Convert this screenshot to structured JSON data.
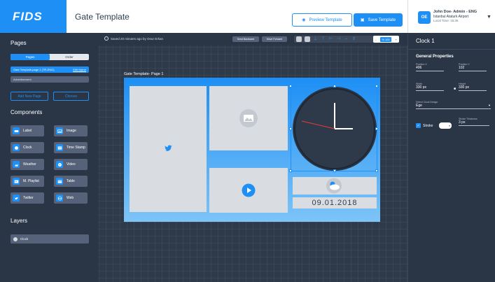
{
  "app": {
    "logo": "FIDS",
    "title": "Gate Template"
  },
  "header": {
    "preview_label": "Preview Template",
    "save_label": "Save Template"
  },
  "user": {
    "initials": "OE",
    "name": "John Doe- Admin - ENG",
    "location": "Istanbul Ataturk Airport",
    "time": "Local Time: 15:35"
  },
  "left": {
    "pages_title": "Pages",
    "tabs": [
      {
        "label": "Pages"
      },
      {
        "label": "Order"
      }
    ],
    "pages": [
      {
        "label": "Gate Template-page 1 (TR-ENG)",
        "edit": "Edit Name"
      },
      {
        "label": "Advertisement"
      }
    ],
    "add_page": "Add New Page",
    "choose": "Choose",
    "components_title": "Components",
    "components": [
      {
        "label": "Label",
        "icon": "label-icon"
      },
      {
        "label": "Image",
        "icon": "image-icon"
      },
      {
        "label": "Clock",
        "icon": "clock-icon"
      },
      {
        "label": "Time Stamp",
        "icon": "timestamp-icon"
      },
      {
        "label": "Weather",
        "icon": "weather-icon"
      },
      {
        "label": "Video",
        "icon": "video-icon"
      },
      {
        "label": "M. Playlist",
        "icon": "playlist-icon"
      },
      {
        "label": "Table",
        "icon": "table-icon"
      },
      {
        "label": "Twitter",
        "icon": "twitter-icon"
      },
      {
        "label": "Web",
        "icon": "web-icon"
      }
    ],
    "layers_title": "Layers",
    "layers": [
      {
        "label": "Clock"
      }
    ]
  },
  "canvas": {
    "saved": "Saved 20 minutes ago by Onur Erkan",
    "send_back": "Send Backward",
    "move_forward": "Move Forward",
    "zoom_minus": "-",
    "zoom_value": "% 100",
    "zoom_plus": "+",
    "page_label": "Gate Template- Page 1",
    "date": "09.01.2018"
  },
  "right": {
    "title": "Clock 1",
    "section": "General Properties",
    "position_x": {
      "label": "Position X",
      "value": "406"
    },
    "position_y": {
      "label": "Position Y",
      "value": "102"
    },
    "width": {
      "label": "Width",
      "value": "330 px"
    },
    "height": {
      "label": "Height",
      "value": "330 px"
    },
    "clock_design": {
      "label": "Select Clock Design",
      "value": "Ege"
    },
    "stroke": {
      "label": "Stroke"
    },
    "stroke_thickness": {
      "label": "Stroke Thickness",
      "value": "3 px"
    }
  },
  "colors": {
    "accent": "#1d8ff5",
    "panel": "#2a3546",
    "canvas": "#2e3a4a"
  }
}
